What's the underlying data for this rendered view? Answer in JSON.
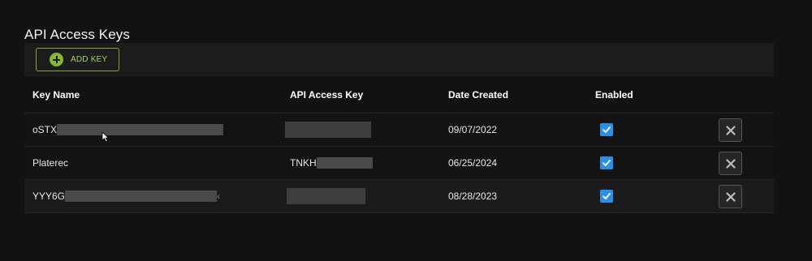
{
  "section": {
    "title": "API Access Keys"
  },
  "toolbar": {
    "add_key_label": "ADD KEY"
  },
  "table": {
    "headers": {
      "key_name": "Key Name",
      "api_access_key": "API Access Key",
      "date_created": "Date Created",
      "enabled": "Enabled"
    },
    "rows": [
      {
        "key_name_visible": "oSTX",
        "api_key_visible": "",
        "date_created": "09/07/2022",
        "enabled": true
      },
      {
        "key_name_visible": "Platerec",
        "api_key_visible": "TNKH",
        "date_created": "06/25/2024",
        "enabled": true
      },
      {
        "key_name_visible": "YYY6G",
        "key_name_trailing": "‹",
        "api_key_visible": "",
        "date_created": "08/28/2023",
        "enabled": true
      }
    ]
  },
  "colors": {
    "background": "#121212",
    "toolbar": "#1c1c1c",
    "accent_green": "#86b831",
    "checkbox_blue": "#2a8fe6"
  },
  "icons": {
    "add": "plus-circle-icon",
    "delete": "close-icon",
    "enabled": "check-icon",
    "cursor": "mouse-pointer-icon"
  }
}
